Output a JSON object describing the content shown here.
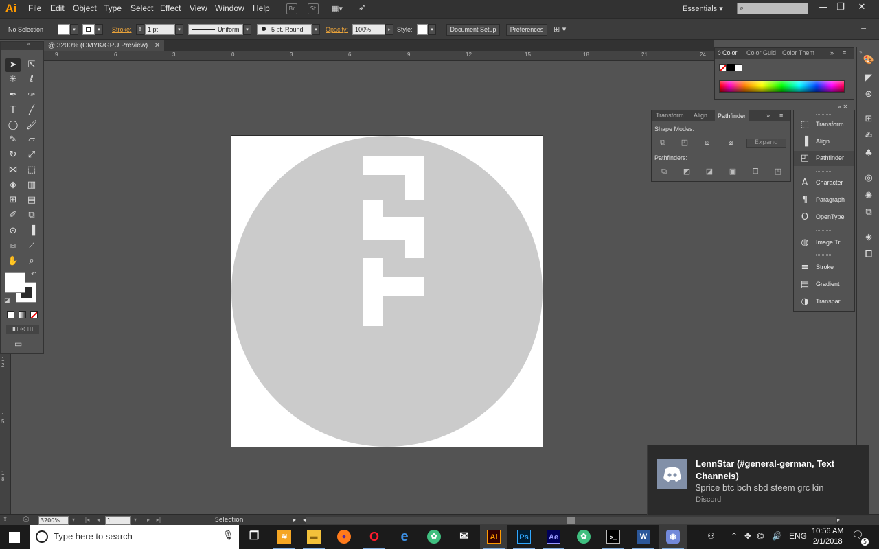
{
  "app": {
    "logo_text": "Ai",
    "menu": [
      "File",
      "Edit",
      "Object",
      "Type",
      "Select",
      "Effect",
      "View",
      "Window",
      "Help"
    ],
    "menubar_icons": [
      "Br",
      "St"
    ],
    "workspace": "Essentials",
    "window_controls": [
      "—",
      "❐",
      "✕"
    ]
  },
  "control_bar": {
    "selection": "No Selection",
    "stroke_label": "Stroke:",
    "stroke_weight": "1 pt",
    "variable_width": "Uniform",
    "brush": "5 pt. Round",
    "opacity_label": "Opacity:",
    "opacity": "100%",
    "style_label": "Style:",
    "document_setup": "Document Setup",
    "preferences": "Preferences"
  },
  "document": {
    "tab_title": "@ 3200% (CMYK/GPU Preview)",
    "ruler_top": [
      "9",
      "6",
      "3",
      "0",
      "3",
      "6",
      "9",
      "12",
      "15",
      "18",
      "21",
      "24"
    ],
    "ruler_left": [
      "1 2",
      "1 5",
      "1 8"
    ]
  },
  "panels": {
    "color": {
      "tabs": [
        "Color",
        "Color Guid",
        "Color Them"
      ]
    },
    "pathfinder": {
      "tabs": [
        "Transform",
        "Align",
        "Pathfinder"
      ],
      "shape_modes": "Shape Modes:",
      "expand": "Expand",
      "pathfinders": "Pathfinders:"
    },
    "dock": [
      {
        "label": "Transform",
        "icon": "transform-icon"
      },
      {
        "label": "Align",
        "icon": "align-icon"
      },
      {
        "label": "Pathfinder",
        "icon": "pathfinder-icon"
      },
      {
        "label": "Character",
        "icon": "character-icon"
      },
      {
        "label": "Paragraph",
        "icon": "paragraph-icon"
      },
      {
        "label": "OpenType",
        "icon": "opentype-icon"
      },
      {
        "label": "Image Tr...",
        "icon": "image-trace-icon"
      },
      {
        "label": "Stroke",
        "icon": "stroke-icon"
      },
      {
        "label": "Gradient",
        "icon": "gradient-icon"
      },
      {
        "label": "Transpar...",
        "icon": "transparency-icon"
      }
    ]
  },
  "status_bar": {
    "zoom": "3200%",
    "artboard": "1",
    "tool": "Selection"
  },
  "notification": {
    "title": "LennStar (#general-german, Text Channels)",
    "message": "$price btc bch sbd steem grc kin",
    "source": "Discord"
  },
  "taskbar": {
    "search_placeholder": "Type here to search",
    "apps": [
      {
        "name": "task-view",
        "glyph": "▭",
        "color": "#ffffff"
      },
      {
        "name": "sticky",
        "glyph": "≋",
        "color": "#f5a623"
      },
      {
        "name": "file-explorer",
        "glyph": "▬",
        "color": "#f3c13a"
      },
      {
        "name": "firefox",
        "glyph": "●",
        "color": "#ff7a1a"
      },
      {
        "name": "opera",
        "glyph": "O",
        "color": "#ff1b2d"
      },
      {
        "name": "edge",
        "glyph": "e",
        "color": "#3c8fe3"
      },
      {
        "name": "app-green",
        "glyph": "✿",
        "color": "#3fbf7f"
      },
      {
        "name": "mail",
        "glyph": "✉",
        "color": "#ffffff"
      },
      {
        "name": "illustrator",
        "glyph": "Ai",
        "color": "#ff9a00"
      },
      {
        "name": "photoshop",
        "glyph": "Ps",
        "color": "#31a8ff"
      },
      {
        "name": "after-effects",
        "glyph": "Ae",
        "color": "#9999ff"
      },
      {
        "name": "app-green-2",
        "glyph": "✿",
        "color": "#3fbf7f"
      },
      {
        "name": "terminal",
        "glyph": "▭",
        "color": "#ffffff"
      },
      {
        "name": "word",
        "glyph": "W",
        "color": "#2b579a"
      },
      {
        "name": "discord",
        "glyph": "◉",
        "color": "#ffffff"
      }
    ],
    "language": "ENG",
    "time": "10:56 AM",
    "date": "2/1/2018",
    "notifications_count": "5"
  },
  "colors": {
    "accent": "#ff9a00",
    "artboard": "#ffffff",
    "circle": "#cbcbcb",
    "discord": "#8290a8",
    "canvas": "#535353"
  }
}
